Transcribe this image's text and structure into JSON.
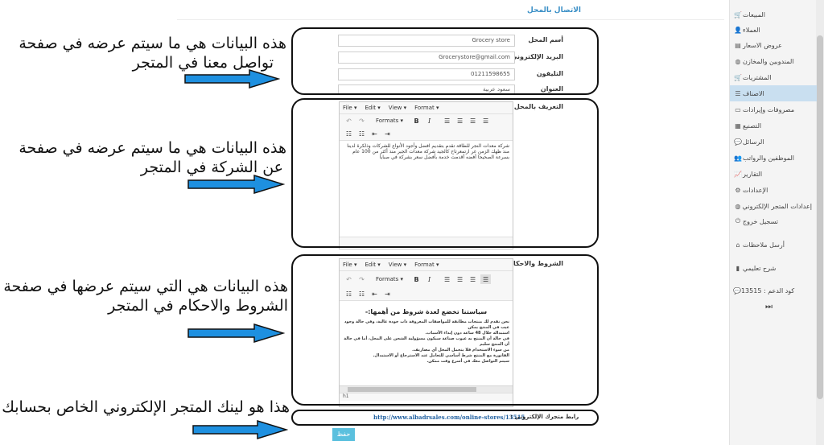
{
  "page": {
    "title": "الاتصال بالمحل"
  },
  "sidebar": {
    "items": [
      {
        "label": "المبيعات",
        "icon": "cart-icon"
      },
      {
        "label": "العملاء",
        "icon": "user-icon"
      },
      {
        "label": "عروض الاسعار",
        "icon": "list-icon"
      },
      {
        "label": "المندوبين والمخازن",
        "icon": "globe-icon"
      },
      {
        "label": "المشتريات",
        "icon": "cart-icon"
      },
      {
        "label": "الاصناف",
        "icon": "list-icon",
        "active": true
      },
      {
        "label": "مصروفات وإيرادات",
        "icon": "cash-icon"
      },
      {
        "label": "التصنيع",
        "icon": "factory-icon"
      },
      {
        "label": "الرسائل",
        "icon": "chat-icon"
      },
      {
        "label": "الموظفين والرواتب",
        "icon": "users-icon"
      },
      {
        "label": "التقارير",
        "icon": "chart-icon"
      },
      {
        "label": "الإعدادات",
        "icon": "gear-icon"
      },
      {
        "label": "إعدادات المتجر الإلكتروني",
        "icon": "globe-icon"
      },
      {
        "label": "تسجيل خروج",
        "icon": "power-icon"
      }
    ],
    "feedback": {
      "label": "أرسل ملاحظات",
      "icon": "home-icon"
    },
    "tutorial": {
      "label": "شرح تعليمي",
      "icon": "book-icon"
    },
    "support": {
      "label": "كود الدعم : 13515",
      "icon": "chat-icon"
    },
    "collapse_glyph": "⏭"
  },
  "form": {
    "store_name": {
      "label": "أسم المحل",
      "value": "Grocery store"
    },
    "email": {
      "label": "البريد الإلكتروني",
      "value": "Grocerystore@gmail.com"
    },
    "phone": {
      "label": "التليفون",
      "value": "01211598655"
    },
    "address": {
      "label": "العنوان",
      "value": "سعود عربية"
    },
    "about": {
      "label": "التعريف بالمحل",
      "text": "شركة معدات النجر للطاقة تقدم بتقديم افضل وأجود الأنواع للشركات وذلكرة لدينا منذ ظهك الزمن غر ارتمعرتاح كالجيد شركة معدات الجير منذ أكثر من 100 عام بسرعة الصحيحا أفضه أقدمت خدمة بأفضل سعر بشركة في صبايا"
    },
    "terms": {
      "label": "الشروط والاحكام",
      "heading": "سياستنا تخضع لعدة شروط من أهمها:-",
      "lines": [
        "نحن نقدم لك منتجات مطابقة للمواصفات المعروفة ذات جودة عالية، وفي حالة وجود عيب في المنتج يمكن",
        "استبداله خلال 48 ساعة دون إبداء الأسباب.",
        "في حالة أن المنتج به عيوب صناعة سيكون مسؤولية الشحن على المحل، أما في حالة أن المنتج سليم",
        "من سوء الاستخدام فلا يتحمل المحل أي مصاريف.",
        "الفاتورة مع المنتج شرط أساسي للتعامل عند الاسترجاع أو الاستبدال.",
        "سيتم التواصل معك في أسرع وقت ممكن."
      ],
      "statusbar": "h1"
    },
    "store_link": {
      "label": "رابط متجرك الإلكتروني :",
      "value": "http://www.albadrsales.com/online-stores/13515"
    },
    "save_label": "حفظ"
  },
  "editor": {
    "menus": [
      "File ▾",
      "Edit ▾",
      "View ▾",
      "Format ▾"
    ],
    "formats_label": "Formats ▾",
    "bold": "B",
    "italic": "I",
    "undo": "↶",
    "redo": "↷"
  },
  "annotations": [
    {
      "line1": "هذه البيانات هي ما سيتم عرضه في صفحة",
      "line2": "تواصل معنا في المتجر"
    },
    {
      "line1": "هذه البيانات هي ما سيتم عرضه في صفحة",
      "line2": "عن الشركة في المتجر"
    },
    {
      "line1": "هذه البيانات هي التي سيتم عرضها في صفحة",
      "line2": "الشروط والاحكام في المتجر"
    },
    {
      "line1": "هذا هو لينك المتجر الإلكتروني الخاص بحسابك",
      "line2": ""
    }
  ],
  "colors": {
    "accent": "#3a8fc6",
    "arrow": "#1e90e0",
    "save": "#5bc0de",
    "active_item": "#c9dff0"
  }
}
